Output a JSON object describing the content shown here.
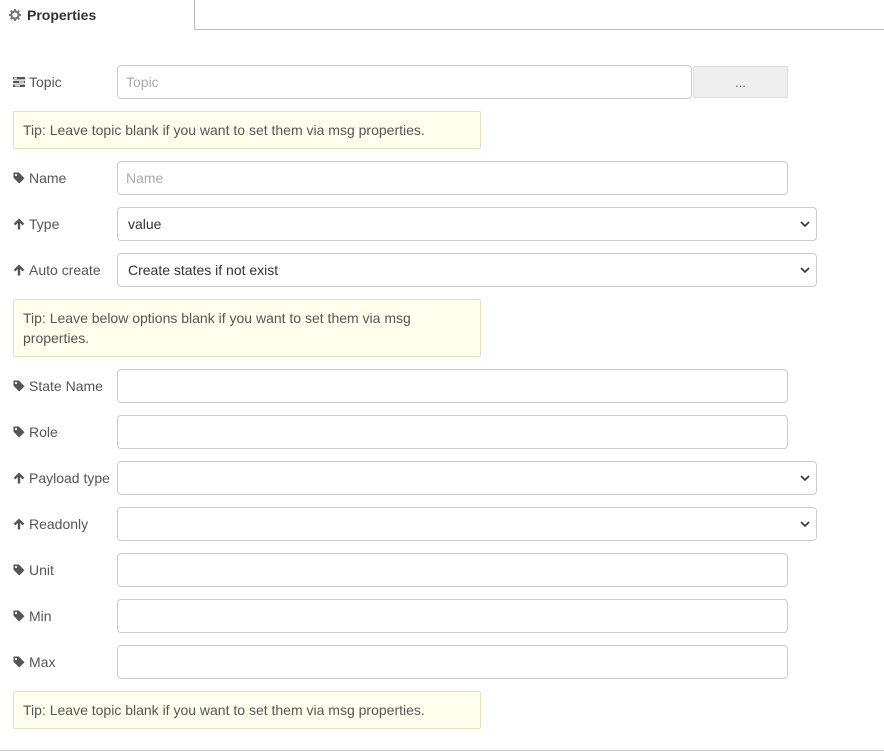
{
  "tab": {
    "label": "Properties",
    "icon": "gear-icon"
  },
  "topic": {
    "label": "Topic",
    "icon": "tasks-icon",
    "placeholder": "Topic",
    "value": "",
    "button_label": "..."
  },
  "tips": {
    "tip1": "Tip: Leave topic blank if you want to set them via msg properties.",
    "tip2": "Tip: Leave below options blank if you want to set them via msg properties.",
    "tip3": "Tip: Leave topic blank if you want to set them via msg properties."
  },
  "fields": {
    "name": {
      "label": "Name",
      "icon": "tag-icon",
      "placeholder": "Name",
      "value": ""
    },
    "type": {
      "label": "Type",
      "icon": "arrow-up-icon",
      "selected": "value"
    },
    "auto_create": {
      "label": "Auto create",
      "icon": "arrow-up-icon",
      "selected": "Create states if not exist"
    },
    "state_name": {
      "label": "State Name",
      "icon": "tag-icon",
      "value": ""
    },
    "role": {
      "label": "Role",
      "icon": "tag-icon",
      "value": ""
    },
    "payload_type": {
      "label": "Payload type",
      "icon": "arrow-up-icon",
      "selected": ""
    },
    "readonly": {
      "label": "Readonly",
      "icon": "arrow-up-icon",
      "selected": ""
    },
    "unit": {
      "label": "Unit",
      "icon": "tag-icon",
      "value": ""
    },
    "min": {
      "label": "Min",
      "icon": "tag-icon",
      "value": ""
    },
    "max": {
      "label": "Max",
      "icon": "tag-icon",
      "value": ""
    }
  },
  "colors": {
    "tip_background": "#ffffee",
    "border": "#cccccc",
    "text": "#555555"
  }
}
